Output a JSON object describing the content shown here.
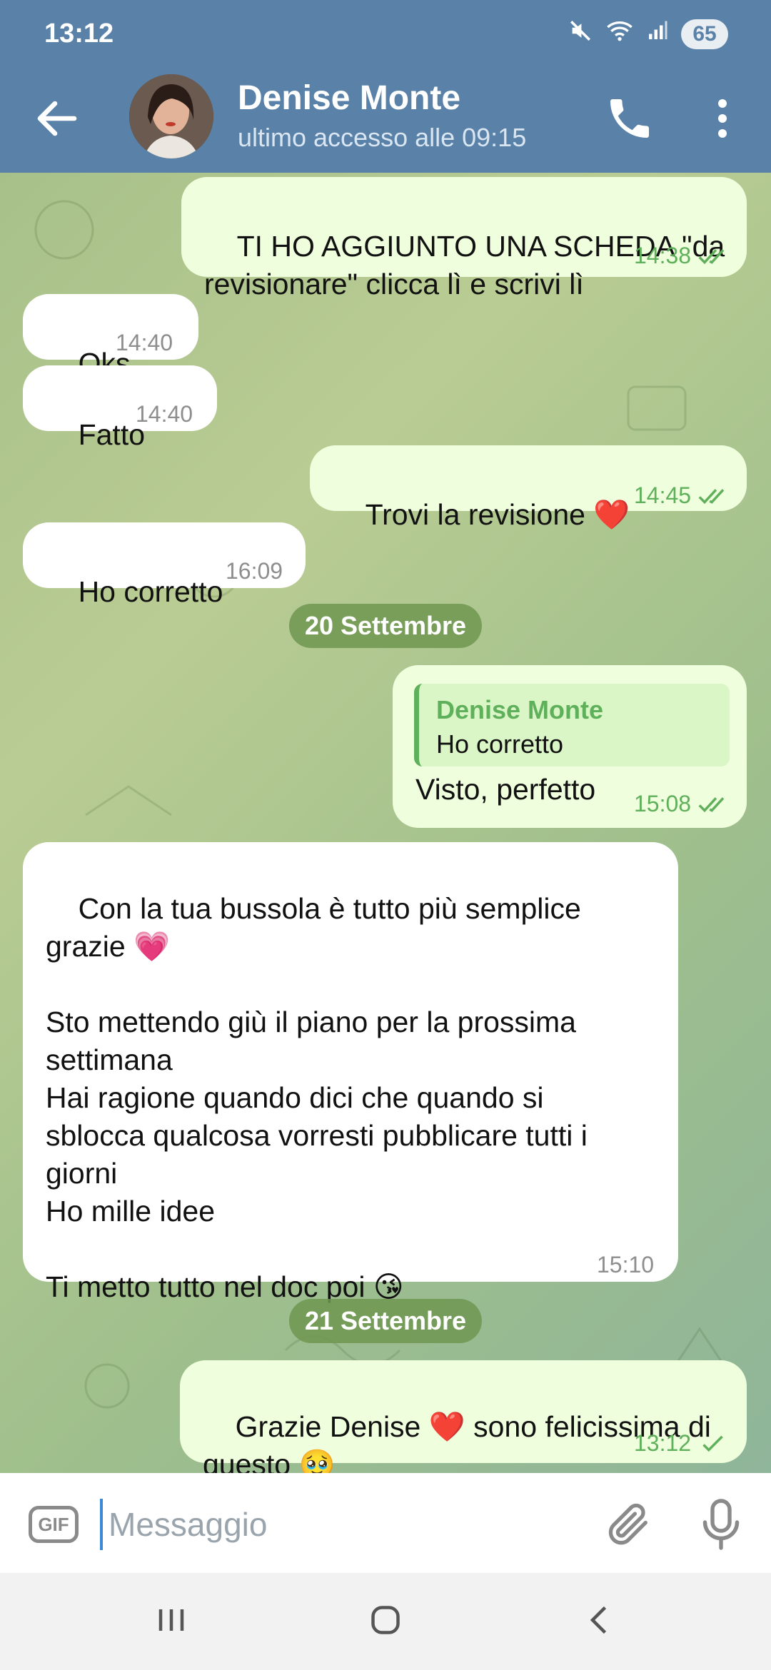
{
  "status_bar": {
    "time": "13:12",
    "battery": "65"
  },
  "header": {
    "contact_name": "Denise Monte",
    "last_seen": "ultimo accesso alle 09:15"
  },
  "messages": [
    {
      "side": "out",
      "text": "TI HO AGGIUNTO UNA SCHEDA \"da\nrevisionare\" clicca lì e scrivi lì",
      "time": "14:38",
      "status": "read"
    },
    {
      "side": "in",
      "text": "Oks",
      "time": "14:40"
    },
    {
      "side": "in",
      "text": "Fatto",
      "time": "14:40"
    },
    {
      "side": "out",
      "text": "Trovi la revisione ❤️",
      "time": "14:45",
      "status": "read"
    },
    {
      "side": "in",
      "text": "Ho corretto",
      "time": "16:09"
    },
    {
      "date": "20 Settembre"
    },
    {
      "side": "out",
      "reply_to": {
        "name": "Denise Monte",
        "text": "Ho corretto"
      },
      "text": "Visto, perfetto",
      "time": "15:08",
      "status": "read"
    },
    {
      "side": "in",
      "text": "Con la tua bussola è tutto più semplice\ngrazie 💗\n\nSto mettendo giù il piano per la prossima\nsettimana\nHai ragione quando dici che quando si\nsblocca qualcosa vorresti pubblicare tutti i\ngiorni\nHo mille idee\n\nTi metto tutto nel doc poi 😘",
      "time": "15:10"
    },
    {
      "date": "21 Settembre"
    },
    {
      "side": "out",
      "text": "Grazie Denise ❤️ sono felicissima di\nquesto 🥹",
      "time": "13:12",
      "status": "sent"
    }
  ],
  "input": {
    "placeholder": "Messaggio",
    "gif_label": "GIF"
  },
  "colors": {
    "header_bg": "#5a82a8",
    "outgoing_bubble": "#effedd",
    "incoming_bubble": "#ffffff",
    "accent_green": "#5fb05a"
  },
  "icons": {
    "back": "arrow-left-icon",
    "call": "phone-icon",
    "menu": "more-vertical-icon",
    "attach": "paperclip-icon",
    "mic": "microphone-icon",
    "read": "double-check-icon",
    "sent": "check-icon"
  }
}
